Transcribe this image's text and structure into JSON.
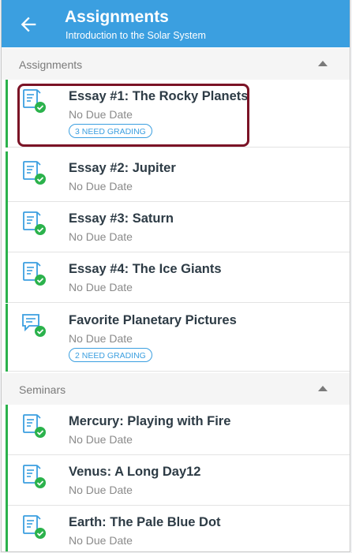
{
  "appbar": {
    "title": "Assignments",
    "subtitle": "Introduction to the Solar System",
    "back_icon": "arrow-left-icon",
    "color": "#3b9fe0"
  },
  "sections": [
    {
      "label": "Assignments",
      "items": [
        {
          "name": "Essay #1: The Rocky Planets",
          "due": "No Due Date",
          "badge": "3 NEED GRADING",
          "icon": "assignment-published-icon"
        },
        {
          "name": "Essay #2: Jupiter",
          "due": "No Due Date",
          "icon": "assignment-published-icon"
        },
        {
          "name": "Essay #3: Saturn",
          "due": "No Due Date",
          "icon": "assignment-published-icon"
        },
        {
          "name": "Essay #4: The Ice Giants",
          "due": "No Due Date",
          "icon": "assignment-published-icon"
        },
        {
          "name": "Favorite Planetary Pictures",
          "due": "No Due Date",
          "badge": "2 NEED GRADING",
          "icon": "discussion-published-icon"
        }
      ]
    },
    {
      "label": "Seminars",
      "items": [
        {
          "name": "Mercury: Playing with Fire",
          "due": "No Due Date",
          "icon": "assignment-published-icon"
        },
        {
          "name": "Venus: A Long Day12",
          "due": "No Due Date",
          "icon": "assignment-published-icon"
        },
        {
          "name": "Earth: The Pale Blue Dot",
          "due": "No Due Date",
          "icon": "assignment-published-icon"
        }
      ]
    }
  ],
  "colors": {
    "published": "#2bb24c",
    "badge": "#3b9fe0",
    "highlight": "#7b1326"
  }
}
